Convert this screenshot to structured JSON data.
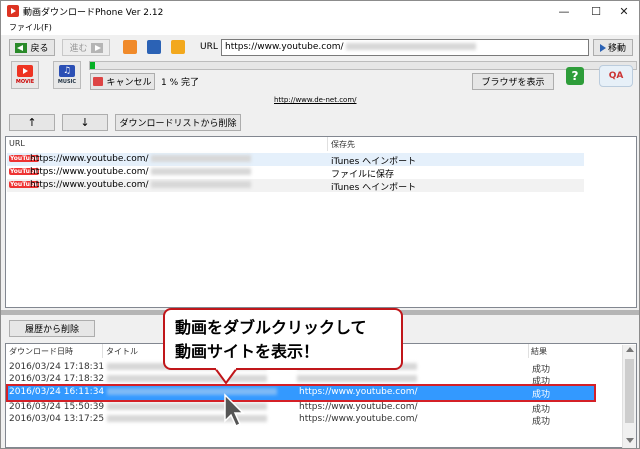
{
  "window": {
    "title": "動画ダウンロードPhone Ver 2.12",
    "controls": [
      "—",
      "☐",
      "✕"
    ]
  },
  "menu": {
    "file": "ファイル(F)"
  },
  "toolbar": {
    "back_label": "戻る",
    "forward_label": "進む",
    "url_label": "URL",
    "url_value": "https://www.youtube.com/",
    "go_label": "移動"
  },
  "actions": {
    "movie_label": "MOVIE",
    "music_label": "MUSIC",
    "cancel_label": "キャンセル",
    "progress_text": "1 % 完了",
    "progress_value": 0.01,
    "show_browser_label": "ブラウザを表示",
    "help_symbol": "?",
    "qa_symbol": "QA"
  },
  "site_link": "http://www.de-net.com/",
  "download_list": {
    "up_label": "↑",
    "down_label": "↓",
    "remove_label": "ダウンロードリストから削除",
    "columns": [
      "URL",
      "保存先"
    ],
    "rows": [
      {
        "url": "https://www.youtube.com/",
        "dest": "iTunes へインポート",
        "icon": "YouTube"
      },
      {
        "url": "https://www.youtube.com/",
        "dest": "ファイルに保存",
        "icon": "YouTube"
      },
      {
        "url": "https://www.youtube.com/",
        "dest": "iTunes へインポート",
        "icon": "YouTube"
      }
    ]
  },
  "history": {
    "remove_label": "履歴から削除",
    "columns": [
      "ダウンロード日時",
      "タイトル",
      "結果"
    ],
    "rows": [
      {
        "datetime": "2016/03/24 17:18:31",
        "url": "",
        "result": "成功"
      },
      {
        "datetime": "2016/03/24 17:18:32",
        "url": "",
        "result": "成功"
      },
      {
        "datetime": "2016/03/24 16:11:34",
        "url": "https://www.youtube.com/",
        "result": "成功"
      },
      {
        "datetime": "2016/03/24 15:50:39",
        "url": "https://www.youtube.com/",
        "result": "成功"
      },
      {
        "datetime": "2016/03/04 13:17:25",
        "url": "https://www.youtube.com/",
        "result": "成功"
      }
    ]
  },
  "callout": {
    "line1": "動画をダブルクリックして",
    "line2": "動画サイトを表示！"
  },
  "colors": {
    "selection": "#3399ff",
    "highlight_border": "#d42027",
    "progress": "#06b025"
  }
}
